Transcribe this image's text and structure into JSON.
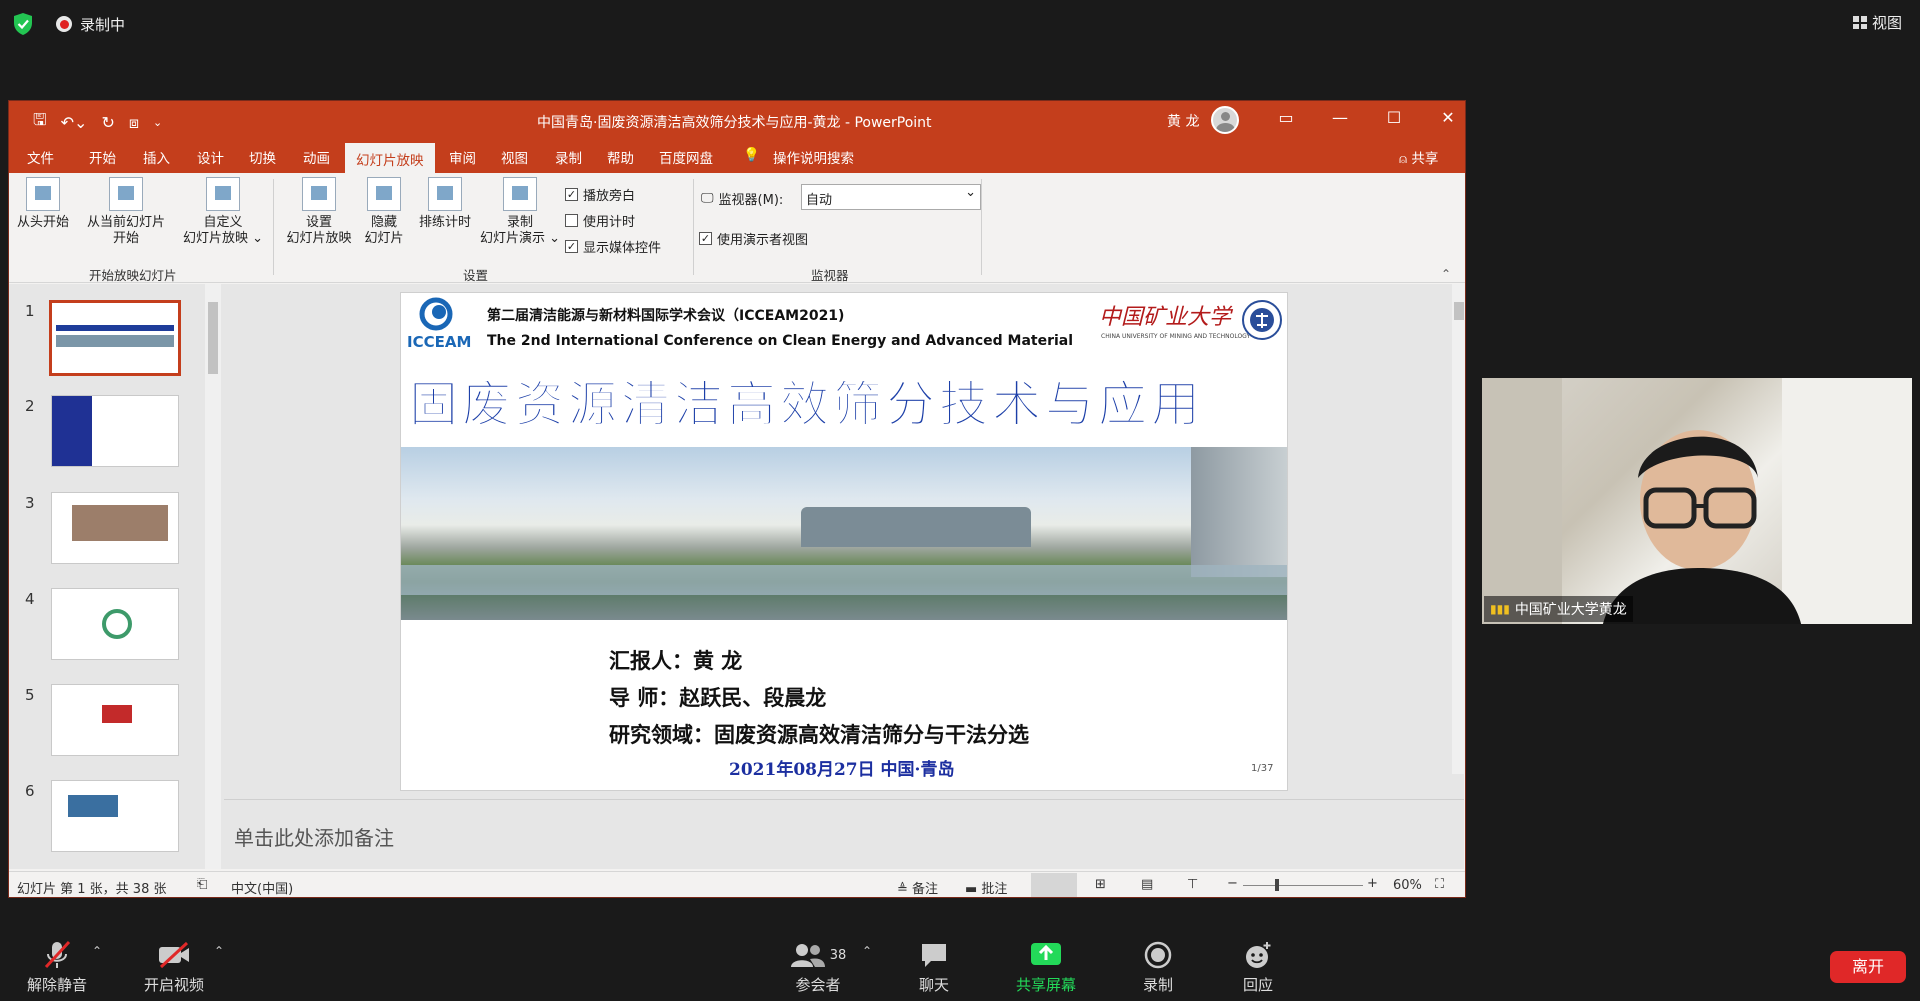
{
  "meeting": {
    "recording_label": "录制中",
    "view_label": "视图",
    "leave_label": "离开",
    "toolbar": {
      "unmute": "解除静音",
      "start_video": "开启视频",
      "participants": "参会者",
      "participants_count": "38",
      "chat": "聊天",
      "share_screen": "共享屏幕",
      "record": "录制",
      "reactions": "回应"
    },
    "camera": {
      "name": "中国矿业大学黄龙"
    },
    "colors": {
      "share_green": "#23d959",
      "leave_red": "#e02828",
      "accent_ppt": "#c43e1c"
    }
  },
  "ppt": {
    "title": "中国青岛·固废资源清洁高效筛分技术与应用-黄龙 - PowerPoint",
    "user": "黄 龙",
    "tabs": [
      "文件",
      "开始",
      "插入",
      "设计",
      "切换",
      "动画",
      "幻灯片放映",
      "审阅",
      "视图",
      "录制",
      "帮助",
      "百度网盘"
    ],
    "active_tab": "幻灯片放映",
    "tell_me": "操作说明搜索",
    "share": "共享",
    "ribbon": {
      "from_beginning": "从头开始",
      "from_current_l1": "从当前幻灯片",
      "from_current_l2": "开始",
      "custom_l1": "自定义",
      "custom_l2": "幻灯片放映 ⌄",
      "group_start": "开始放映幻灯片",
      "setup_l1": "设置",
      "setup_l2": "幻灯片放映",
      "hide_l1": "隐藏",
      "hide_l2": "幻灯片",
      "rehearse": "排练计时",
      "record_l1": "录制",
      "record_l2": "幻灯片演示 ⌄",
      "chk_narration": "播放旁白",
      "chk_timings": "使用计时",
      "chk_media": "显示媒体控件",
      "group_setup": "设置",
      "monitor_label": "监视器(M):",
      "monitor_value": "自动",
      "presenter_view": "使用演示者视图",
      "group_monitor": "监视器"
    },
    "thumbnails": [
      "1",
      "2",
      "3",
      "4",
      "5",
      "6"
    ],
    "slide": {
      "conf_cn": "第二届清洁能源与新材料国际学术会议（ICCEAM2021)",
      "conf_en": "The 2nd International Conference on Clean Energy and Advanced Material",
      "logo_text": "ICCEAM",
      "univ_cn": "中国矿业大学",
      "univ_en": "CHINA UNIVERSITY OF MINING AND TECHNOLOGY",
      "main_title": "固废资源清洁高效筛分技术与应用",
      "reporter": "汇报人：黄  龙",
      "advisor": "导  师：赵跃民、段晨龙",
      "field": "研究领域：固废资源高效清洁筛分与干法分选",
      "date_place": "2021年08月27日    中国·青岛",
      "page": "1/37"
    },
    "notes_placeholder": "单击此处添加备注",
    "status": {
      "slide_count": "幻灯片 第 1 张，共 38 张",
      "language": "中文(中国)",
      "notes": "备注",
      "comments": "批注",
      "zoom": "60%"
    }
  }
}
